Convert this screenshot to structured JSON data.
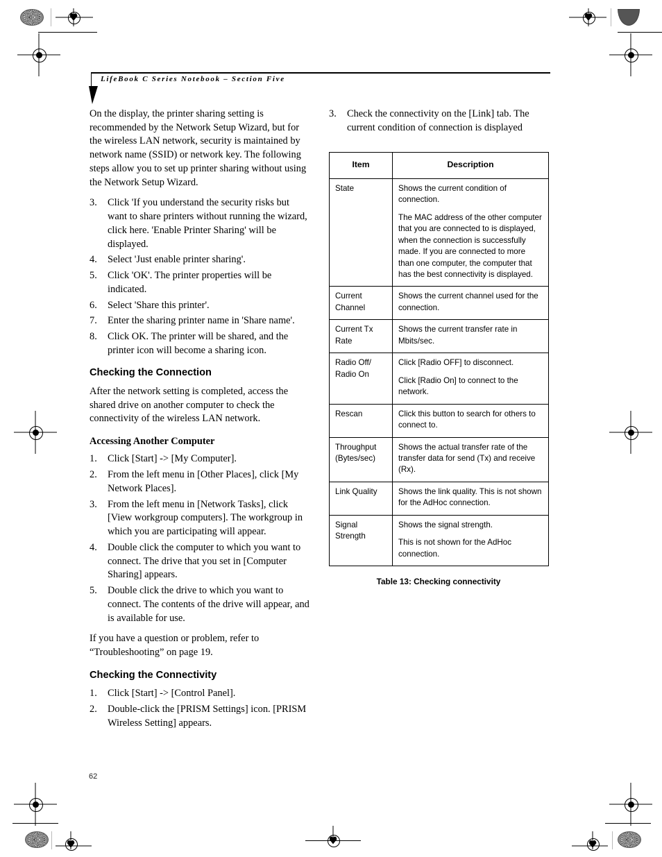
{
  "header": {
    "title": "LifeBook C Series Notebook – Section Five"
  },
  "page_number": "62",
  "left_column": {
    "intro_paragraph": "On the display, the printer sharing setting is recommended by the Network Setup Wizard, but for the wireless LAN network, security is maintained by network name (SSID) or network key. The following steps allow you to set up printer sharing without using the Network Setup Wizard.",
    "printer_steps": [
      {
        "num": "3.",
        "text": "Click 'If you understand the security risks but want to share printers without running the wizard, click here. 'Enable Printer Sharing' will be displayed."
      },
      {
        "num": "4.",
        "text": "Select 'Just enable printer sharing'."
      },
      {
        "num": "5.",
        "text": "Click 'OK'. The printer properties will be indicated."
      },
      {
        "num": "6.",
        "text": "Select 'Share this printer'."
      },
      {
        "num": "7.",
        "text": "Enter the sharing printer name in 'Share name'."
      },
      {
        "num": "8.",
        "text": "Click OK. The printer will be shared, and the printer icon will become a sharing icon."
      }
    ],
    "checking_connection_heading": "Checking the Connection",
    "checking_connection_paragraph": "After the network setting is completed, access the shared drive on another computer to check the connectivity of the wireless LAN network.",
    "accessing_subheading": "Accessing Another Computer",
    "accessing_steps": [
      {
        "num": "1.",
        "text": "Click [Start] -> [My Computer]."
      },
      {
        "num": "2.",
        "text": "From the left menu in [Other Places], click [My Network Places]."
      },
      {
        "num": "3.",
        "text": "From the left menu in [Network Tasks], click [View workgroup computers]. The workgroup in which you are participating will appear."
      },
      {
        "num": "4.",
        "text": "Double click the computer to which you want to connect. The drive that you set in [Computer Sharing] appears."
      },
      {
        "num": "5.",
        "text": "Double click the drive to which you want to connect. The contents of the drive will appear, and is available for use."
      }
    ],
    "troubleshooting_paragraph": "If you have a question or problem, refer to “Troubleshooting” on page 19.",
    "checking_connectivity_heading": "Checking the Connectivity",
    "connectivity_steps": [
      {
        "num": "1.",
        "text": "Click [Start] -> [Control Panel]."
      },
      {
        "num": "2.",
        "text": "Double-click the [PRISM Settings] icon. [PRISM Wireless Setting] appears."
      }
    ]
  },
  "right_column": {
    "step_three": {
      "num": "3.",
      "text": "Check the connectivity on the [Link] tab. The current condition of connection is displayed"
    },
    "table": {
      "headers": {
        "item": "Item",
        "description": "Description"
      },
      "rows": [
        {
          "item": "State",
          "description": [
            "Shows the current condition of connection.",
            "The MAC address of the other computer that you are connected to is displayed, when the connection is successfully made. If you are connected to more than one computer, the computer that has the best connectivity is displayed."
          ]
        },
        {
          "item": "Current Channel",
          "description": [
            "Shows the current channel used for the connection."
          ]
        },
        {
          "item": "Current Tx Rate",
          "description": [
            "Shows the current transfer rate in Mbits/sec."
          ]
        },
        {
          "item": "Radio Off/ Radio On",
          "description": [
            "Click [Radio OFF] to disconnect.",
            "Click [Radio On] to connect to the network."
          ]
        },
        {
          "item": "Rescan",
          "description": [
            "Click this button to search for others to connect to."
          ]
        },
        {
          "item": "Throughput (Bytes/sec)",
          "description": [
            "Shows the actual transfer rate of the transfer data for send (Tx) and receive (Rx)."
          ]
        },
        {
          "item": "Link Quality",
          "description": [
            "Shows the link quality. This is not shown for the AdHoc connection."
          ]
        },
        {
          "item": "Signal Strength",
          "description": [
            "Shows the signal strength.",
            "This is not shown for the AdHoc connection."
          ]
        }
      ],
      "caption": "Table 13: Checking connectivity"
    }
  }
}
